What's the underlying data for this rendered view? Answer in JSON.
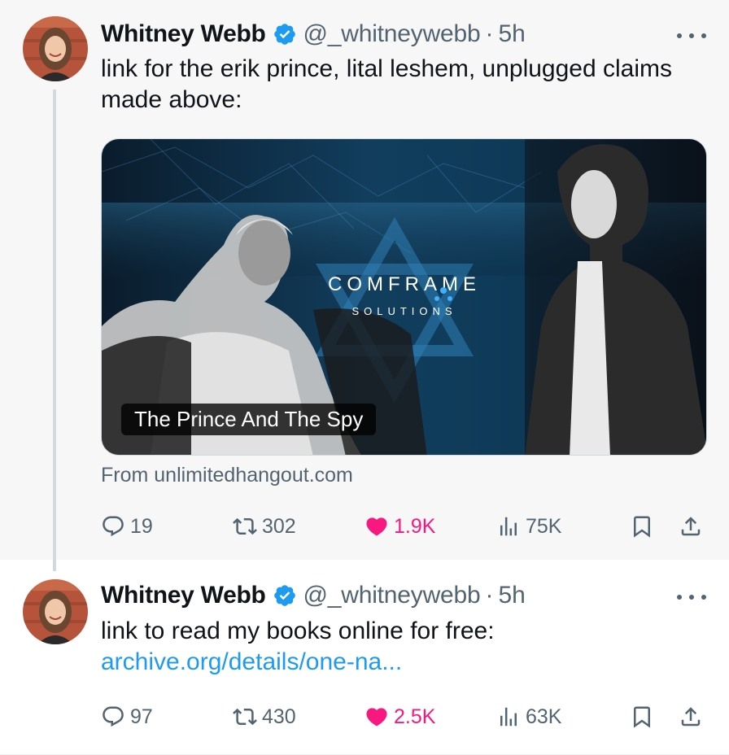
{
  "thread": [
    {
      "author": {
        "name": "Whitney Webb",
        "handle": "@_whitneywebb",
        "separator": "·",
        "time": "5h",
        "verified": true
      },
      "text": "link for the erik prince, lital leshem, unplugged claims made above:",
      "card": {
        "image_logo_line1": "COMFRAME",
        "image_logo_line2": "SOLUTIONS",
        "title": "The Prince And The Spy",
        "source": "From unlimitedhangout.com"
      },
      "stats": {
        "replies": "19",
        "retweets": "302",
        "likes": "1.9K",
        "views": "75K"
      }
    },
    {
      "author": {
        "name": "Whitney Webb",
        "handle": "@_whitneywebb",
        "separator": "·",
        "time": "5h",
        "verified": true
      },
      "text": "link to read my books online for free: ",
      "link_text": "archive.org/details/one-na...",
      "stats": {
        "replies": "97",
        "retweets": "430",
        "likes": "2.5K",
        "views": "63K"
      }
    }
  ],
  "icons": {
    "more": "more-icon",
    "reply": "reply-icon",
    "retweet": "retweet-icon",
    "like": "heart-icon",
    "views": "views-icon",
    "bookmark": "bookmark-icon",
    "share": "share-icon",
    "verified": "verified-badge-icon"
  },
  "colors": {
    "accent": "#1d9bf0",
    "like": "#f91880",
    "secondary_text": "#536471",
    "thread_line": "#cfd9de"
  }
}
